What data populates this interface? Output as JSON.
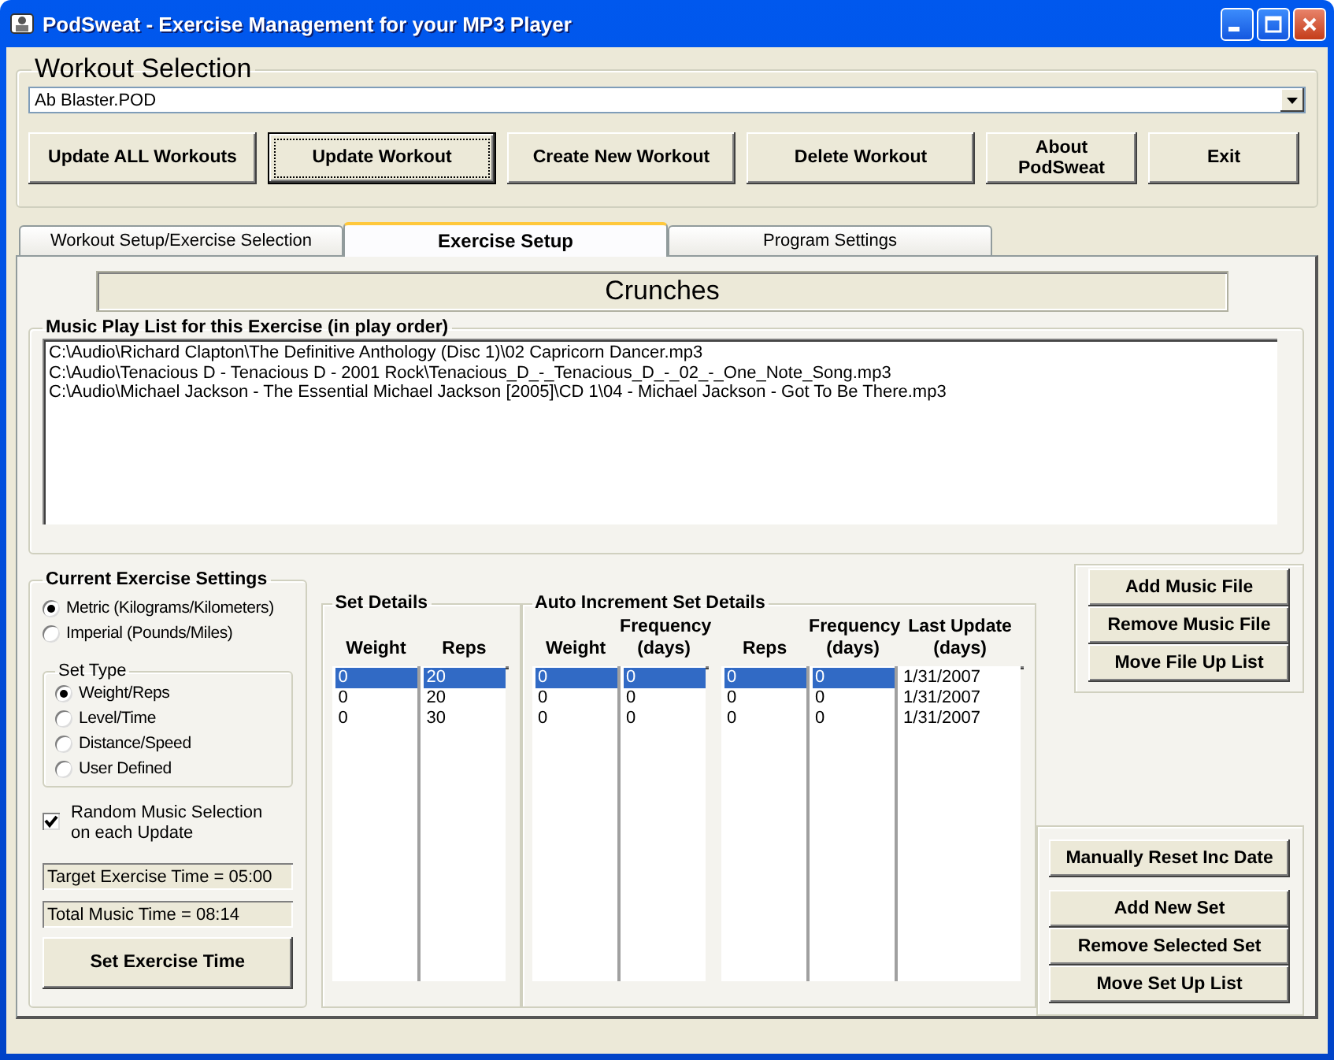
{
  "window": {
    "title": "PodSweat - Exercise Management for your MP3 Player"
  },
  "workout_selection": {
    "title": "Workout Selection",
    "dropdown": {
      "value": "Ab Blaster.POD"
    },
    "buttons": [
      {
        "label": "Update ALL Workouts",
        "focused": false
      },
      {
        "label": "Update Workout",
        "focused": true
      },
      {
        "label": "Create New Workout",
        "focused": false
      },
      {
        "label": "Delete Workout",
        "focused": false
      },
      {
        "label": "About\nPodSweat",
        "focused": false
      },
      {
        "label": "Exit",
        "focused": false
      }
    ]
  },
  "tabs": [
    {
      "label": "Workout Setup/Exercise Selection",
      "selected": false
    },
    {
      "label": "Exercise Setup",
      "selected": true
    },
    {
      "label": "Program Settings",
      "selected": false
    }
  ],
  "exercise_name": "Crunches",
  "music_playlist": {
    "title": "Music Play List for this Exercise (in play order)",
    "files": [
      "C:\\Audio\\Richard Clapton\\The Definitive Anthology (Disc 1)\\02 Capricorn Dancer.mp3",
      "C:\\Audio\\Tenacious D - Tenacious D - 2001 Rock\\Tenacious_D_-_Tenacious_D_-_02_-_One_Note_Song.mp3",
      "C:\\Audio\\Michael Jackson - The Essential Michael Jackson [2005]\\CD 1\\04 - Michael Jackson - Got To Be There.mp3"
    ]
  },
  "music_buttons": [
    "Add Music File",
    "Remove Music File",
    "Move File Up List"
  ],
  "current_exercise_settings": {
    "title": "Current Exercise Settings",
    "units": [
      {
        "label": "Metric (Kilograms/Kilometers)",
        "selected": true
      },
      {
        "label": "Imperial (Pounds/Miles)",
        "selected": false
      }
    ],
    "set_type": {
      "title": "Set Type",
      "options": [
        {
          "label": "Weight/Reps",
          "selected": true
        },
        {
          "label": "Level/Time",
          "selected": false
        },
        {
          "label": "Distance/Speed",
          "selected": false
        },
        {
          "label": "User Defined",
          "selected": false
        }
      ]
    },
    "random_music": {
      "label": "Random Music Selection\non each Update",
      "checked": true
    },
    "target_time": "Target Exercise Time = 05:00",
    "total_music_time": "Total Music Time = 08:14",
    "set_time_button": "Set Exercise Time"
  },
  "set_details": {
    "title": "Set Details",
    "lists": [
      {
        "columns": [
          {
            "header": "Weight",
            "items": [
              {
                "value": "0",
                "selected": true
              },
              {
                "value": "0",
                "selected": false
              },
              {
                "value": "0",
                "selected": false
              }
            ]
          },
          {
            "header": "Reps",
            "items": [
              {
                "value": "20",
                "selected": true
              },
              {
                "value": "20",
                "selected": false
              },
              {
                "value": "30",
                "selected": false
              }
            ]
          }
        ]
      }
    ]
  },
  "auto_increment": {
    "title": "Auto Increment Set Details",
    "lists": [
      {
        "columns": [
          {
            "header": "Weight",
            "items": [
              {
                "value": "0",
                "selected": true
              },
              {
                "value": "0",
                "selected": false
              },
              {
                "value": "0",
                "selected": false
              }
            ]
          },
          {
            "header": "Frequency\n(days)",
            "items": [
              {
                "value": "0",
                "selected": true
              },
              {
                "value": "0",
                "selected": false
              },
              {
                "value": "0",
                "selected": false
              }
            ]
          }
        ]
      },
      {
        "columns": [
          {
            "header": "Reps",
            "items": [
              {
                "value": "0",
                "selected": true
              },
              {
                "value": "0",
                "selected": false
              },
              {
                "value": "0",
                "selected": false
              }
            ]
          },
          {
            "header": "Frequency\n(days)",
            "items": [
              {
                "value": "0",
                "selected": true
              },
              {
                "value": "0",
                "selected": false
              },
              {
                "value": "0",
                "selected": false
              }
            ]
          },
          {
            "header": "Last Update\n(days)",
            "items": [
              {
                "value": "1/31/2007",
                "selected": false
              },
              {
                "value": "1/31/2007",
                "selected": false
              },
              {
                "value": "1/31/2007",
                "selected": false
              }
            ]
          }
        ]
      }
    ]
  },
  "reset_button": "Manually Reset Inc Date",
  "set_buttons": [
    "Add New Set",
    "Remove Selected Set",
    "Move Set Up List"
  ]
}
